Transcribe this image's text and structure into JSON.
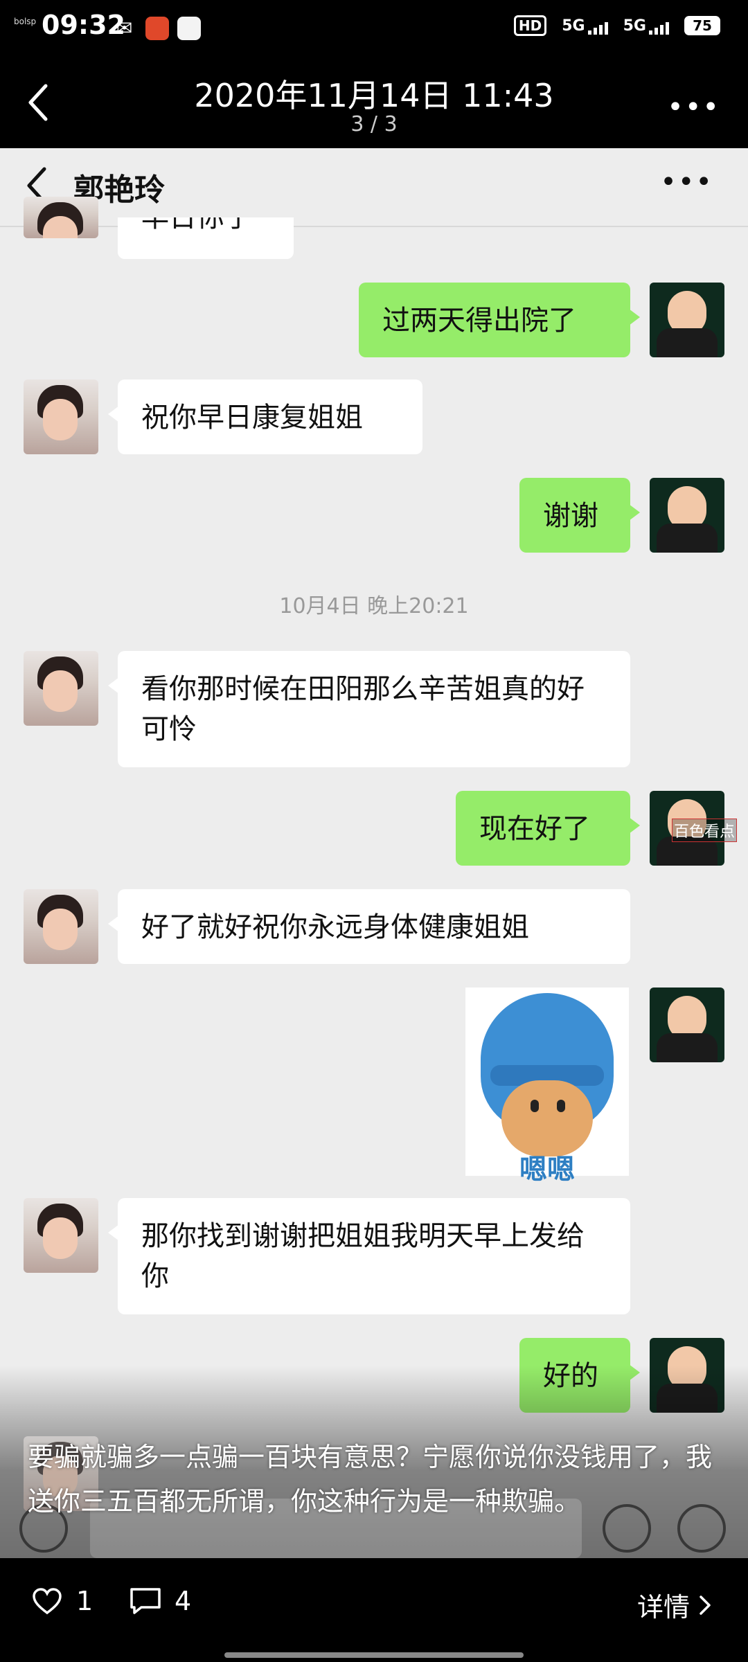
{
  "status_bar": {
    "time": "09:32",
    "tiny_text": "bolsp",
    "network_badge": "HD",
    "signal1": "5G",
    "signal2": "5G",
    "battery": "75"
  },
  "viewer": {
    "title": "2020年11月14日 11:43",
    "page_indicator": "3 / 3"
  },
  "chat": {
    "contact_name": "郭艳玲",
    "partial_top_text": "早日你了",
    "messages": [
      {
        "side": "right",
        "text": "过两天得出院了"
      },
      {
        "side": "left",
        "text": "祝你早日康复姐姐"
      },
      {
        "side": "right",
        "text": "谢谢"
      },
      {
        "side": "left",
        "text": "看你那时候在田阳那么辛苦姐真的好可怜"
      },
      {
        "side": "right",
        "text": "现在好了"
      },
      {
        "side": "left",
        "text": "好了就好祝你永远身体健康姐姐"
      },
      {
        "side": "right",
        "sticker_caption": "嗯嗯"
      },
      {
        "side": "left",
        "text": "那你找到谢谢把姐姐我明天早上发给你"
      },
      {
        "side": "right",
        "text": "好的"
      }
    ],
    "timestamp": "10月4日 晚上20:21",
    "watermark": "百色看点"
  },
  "caption": "要骗就骗多一点骗一百块有意思？宁愿你说你没钱用了，我送你三五百都无所谓，你这种行为是一种欺骗。",
  "bottom_bar": {
    "likes": "1",
    "comments": "4",
    "detail_label": "详情"
  }
}
